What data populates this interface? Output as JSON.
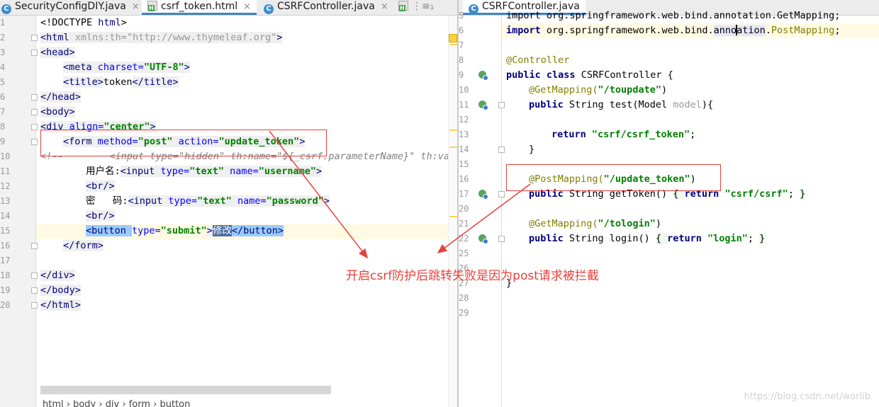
{
  "left_editor": {
    "tabs": [
      {
        "label": "SecurityConfigDIY.java",
        "icon": "java-class-icon",
        "active": false
      },
      {
        "label": "csrf_token.html",
        "icon": "html-file-icon",
        "active": true
      },
      {
        "label": "CSRFController.java",
        "icon": "java-class-icon",
        "active": false
      }
    ],
    "overflow_label": "⋮≡₁",
    "line_numbers": [
      "1",
      "2",
      "3",
      "4",
      "5",
      "6",
      "7",
      "8",
      "9",
      "10",
      "11",
      "12",
      "13",
      "14",
      "15",
      "16",
      "17",
      "18",
      "19",
      "20"
    ],
    "code": {
      "l1a": "<!DOCTYPE ",
      "l1b": "html",
      "l1c": ">",
      "l2_tag_open": "<html ",
      "l2_attr": "xmlns:th=",
      "l2_val": "\"http://www.thymeleaf.org\"",
      "l2_close": ">",
      "l3": "<head>",
      "l4_tag": "<meta ",
      "l4_attr": "charset=",
      "l4_val": "\"UTF-8\"",
      "l4_close": ">",
      "l5_open": "<title>",
      "l5_text": "token",
      "l5_close": "</title>",
      "l6": "</head>",
      "l7": "<body>",
      "l8_tag": "<div ",
      "l8_attr": "align=",
      "l8_val": "\"center\"",
      "l8_close": ">",
      "l9_tag": "<form ",
      "l9_attr1": "method=",
      "l9_val1": "\"post\"",
      "l9_attr2": "action=",
      "l9_val2": "\"update_token\"",
      "l9_close": ">",
      "l10": "<!--        <input type=\"hidden\" th:name=\"${_csrf.parameterName}\" th:value",
      "l11_label": "用户名:",
      "l11_tag": "<input ",
      "l11_attr1": "type=",
      "l11_val1": "\"text\"",
      "l11_attr2": "name=",
      "l11_val2": "\"username\"",
      "l11_close": ">",
      "l12": "<br/>",
      "l13_label": "密   码:",
      "l13_tag": "<input ",
      "l13_attr1": "type=",
      "l13_val1": "\"text\"",
      "l13_attr2": "name=",
      "l13_val2": "\"password\"",
      "l13_close": ">",
      "l14": "<br/>",
      "l15_tag": "<button ",
      "l15_attr": "type=",
      "l15_val": "\"submit\"",
      "l15_gt": ">",
      "l15_text": "修改",
      "l15_close": "</button>",
      "l16": "</form>",
      "l18": "</div>",
      "l19": "</body>",
      "l20": "</html>"
    },
    "breadcrumb": "html  ›  body  ›  div  ›  form  ›  button"
  },
  "right_editor": {
    "tab": {
      "label": "CSRFController.java",
      "icon": "java-class-icon"
    },
    "line_numbers": [
      "5",
      "6",
      "7",
      "8",
      "9",
      "10",
      "11",
      "12",
      "13",
      "14",
      "15",
      "16",
      "17",
      "20",
      "21",
      "22",
      "25",
      "26",
      "27",
      "28",
      "29"
    ],
    "code": {
      "l5": "import org.springframework.web.bind.annotation.GetMapping;",
      "l6_kw": "import",
      "l6_a": " org.springframework.web.bind.",
      "l6_b": "anno",
      "l6_c": "ation",
      "l6_d": ".",
      "l6_e": "PostMapping",
      "l6_f": ";",
      "l8": "@Controller",
      "l9_kw1": "public",
      "l9_kw2": " class",
      "l9_rest": " CSRFController {",
      "l10_ann": "@GetMapping(",
      "l10_str": "\"/toupdate\"",
      "l10_end": ")",
      "l11_kw": "public",
      "l11_a": " String test(Model ",
      "l11_p": "model",
      "l11_b": "){",
      "l13_kw": "return",
      "l13_str": " \"csrf/csrf_token\"",
      "l13_end": ";",
      "l14": "}",
      "l16_ann": "@PostMapping(",
      "l16_str": "\"/update_token\"",
      "l16_end": ")",
      "l17_kw": "public",
      "l17_a": " String getToken() ",
      "l17_b1": "{ ",
      "l17_kw2": "return",
      "l17_str": " \"csrf/csrf\"",
      "l17_c": "; ",
      "l17_b2": "}",
      "l21_ann": "@GetMapping(",
      "l21_str": "\"/tologin\"",
      "l21_end": ")",
      "l22_kw": "public",
      "l22_a": " String login() ",
      "l22_b1": "{ ",
      "l22_kw2": "return",
      "l22_str": " \"login\"",
      "l22_c": "; ",
      "l22_b2": "}",
      "l26": "}"
    }
  },
  "annotation": {
    "text": "开启csrf防护后跳转失败是因为post请求被拦截",
    "color": "#e8413a"
  },
  "watermark": "https://blog.csdn.net/worlib",
  "colors": {
    "tag": "#000080",
    "attr": "#0000ff",
    "string": "#008000",
    "annotation": "#808000",
    "comment": "#808080",
    "tab_underline": "#4083c9",
    "current_line": "#fffae3",
    "selection": "#4a6fa5"
  }
}
